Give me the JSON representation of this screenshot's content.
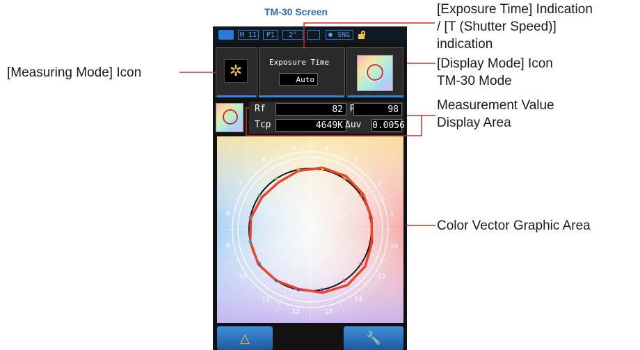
{
  "title": "TM-30 Screen",
  "callouts": {
    "exposure_line1": "[Exposure Time] Indication",
    "exposure_line2": "/ [T (Shutter Speed)]",
    "exposure_line3": "indication",
    "measuring_mode": "[Measuring Mode] Icon",
    "display_mode_line1": "[Display Mode] Icon",
    "display_mode_line2": "TM-30 Mode",
    "measurement_line1": "Measurement Value",
    "measurement_line2": "Display Area",
    "color_vector": "Color Vector Graphic Area"
  },
  "status_bar": {
    "memory": "M 11",
    "preset": "P1",
    "angle": "2°",
    "mode": "SNG"
  },
  "exposure": {
    "label": "Exposure Time",
    "value": "Auto"
  },
  "measurements": {
    "rf_label": "Rf",
    "rf_value": "82",
    "rg_label": "Rg",
    "rg_value": "98",
    "tcp_label": "Tcp",
    "tcp_value": "4649K",
    "duv_label": "Δuv",
    "duv_value": "0.0056"
  },
  "hue_bins": [
    "1",
    "2",
    "3",
    "4",
    "5",
    "6",
    "7",
    "8",
    "9",
    "10",
    "11",
    "12",
    "13",
    "14",
    "15",
    "16"
  ],
  "colors": {
    "accent_red": "#d42a2a",
    "title_blue": "#2a6db4",
    "ui_blue": "#2e86e0",
    "vector_red": "#e8452c",
    "icon_yellow": "#f3c34a"
  },
  "icons": {
    "measuring_mode": "sun-icon",
    "display_mode": "tm30-circle-icon",
    "left_button": "delta-icon",
    "right_button": "wrench-icon"
  }
}
